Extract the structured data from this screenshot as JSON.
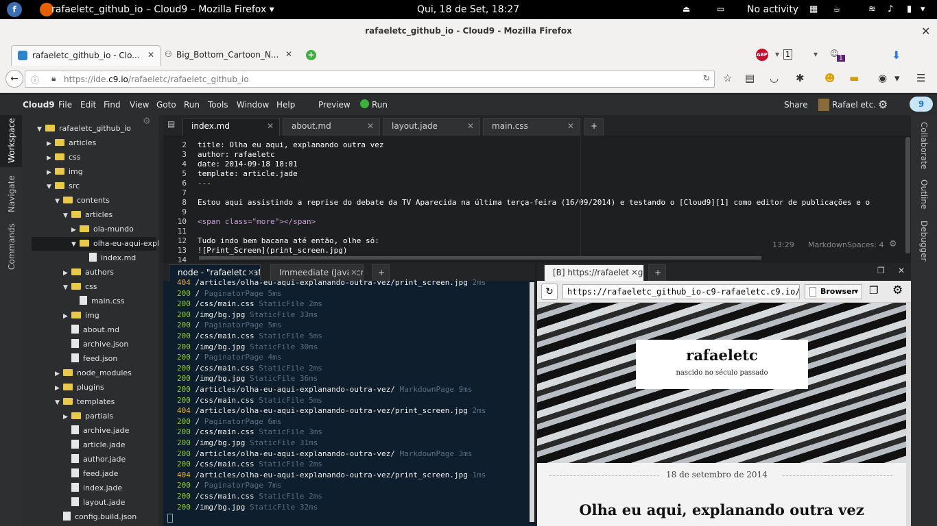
{
  "gnome": {
    "app_title": "rafaeletc_github_io – Cloud9 – Mozilla Firefox ▾",
    "clock": "Qui, 18 de Set, 18:27",
    "activity": "No activity"
  },
  "firefox": {
    "window_title": "rafaeletc_github_io - Cloud9 - Mozilla Firefox",
    "tabs": [
      {
        "label": "rafaeletc_github_io - Clo..."
      },
      {
        "label": "Big_Bottom_Cartoon_N..."
      }
    ],
    "url_prefix": "https://ide.",
    "url_host": "c9.io",
    "url_path": "/rafaeletc/rafaeletc_github_io",
    "badge_count": "1",
    "abp": "ABP"
  },
  "c9menu": {
    "items": [
      "Cloud9",
      "File",
      "Edit",
      "Find",
      "View",
      "Goto",
      "Run",
      "Tools",
      "Window",
      "Help"
    ],
    "preview": "Preview",
    "run": "Run",
    "share": "Share",
    "user": "Rafael etc."
  },
  "rails": {
    "left": [
      "Workspace",
      "Navigate",
      "Commands"
    ],
    "right": [
      "Collaborate",
      "Outline",
      "Debugger"
    ]
  },
  "tree": [
    {
      "label": "rafaeletc_github_io",
      "type": "folder",
      "open": true,
      "depth": 0
    },
    {
      "label": "articles",
      "type": "folder",
      "open": false,
      "depth": 1
    },
    {
      "label": "css",
      "type": "folder",
      "open": false,
      "depth": 1
    },
    {
      "label": "img",
      "type": "folder",
      "open": false,
      "depth": 1
    },
    {
      "label": "src",
      "type": "folder",
      "open": true,
      "depth": 1
    },
    {
      "label": "contents",
      "type": "folder",
      "open": true,
      "depth": 2
    },
    {
      "label": "articles",
      "type": "folder",
      "open": true,
      "depth": 3
    },
    {
      "label": "ola-mundo",
      "type": "folder",
      "open": false,
      "depth": 4
    },
    {
      "label": "olha-eu-aqui-expla",
      "type": "folder",
      "open": true,
      "depth": 4
    },
    {
      "label": "index.md",
      "type": "file",
      "depth": 5
    },
    {
      "label": "authors",
      "type": "folder",
      "open": false,
      "depth": 3
    },
    {
      "label": "css",
      "type": "folder",
      "open": true,
      "depth": 3
    },
    {
      "label": "main.css",
      "type": "file",
      "depth": 4
    },
    {
      "label": "img",
      "type": "folder",
      "open": false,
      "depth": 3
    },
    {
      "label": "about.md",
      "type": "file",
      "depth": 3
    },
    {
      "label": "archive.json",
      "type": "file",
      "depth": 3
    },
    {
      "label": "feed.json",
      "type": "file",
      "depth": 3
    },
    {
      "label": "node_modules",
      "type": "folder",
      "open": false,
      "depth": 2
    },
    {
      "label": "plugins",
      "type": "folder",
      "open": false,
      "depth": 2
    },
    {
      "label": "templates",
      "type": "folder",
      "open": true,
      "depth": 2
    },
    {
      "label": "partials",
      "type": "folder",
      "open": false,
      "depth": 3
    },
    {
      "label": "archive.jade",
      "type": "file",
      "depth": 3
    },
    {
      "label": "article.jade",
      "type": "file",
      "depth": 3
    },
    {
      "label": "author.jade",
      "type": "file",
      "depth": 3
    },
    {
      "label": "feed.jade",
      "type": "file",
      "depth": 3
    },
    {
      "label": "index.jade",
      "type": "file",
      "depth": 3
    },
    {
      "label": "layout.jade",
      "type": "file",
      "depth": 3
    },
    {
      "label": "config.build.json",
      "type": "file",
      "depth": 2
    }
  ],
  "editor_tabs": [
    "index.md",
    "about.md",
    "layout.jade",
    "main.css"
  ],
  "editor_lines": [
    {
      "n": "2",
      "t": "title: Olha eu aqui, explanando outra vez"
    },
    {
      "n": "3",
      "t": "author: rafaeletc"
    },
    {
      "n": "4",
      "t": "date: 2014-09-18 18:01"
    },
    {
      "n": "5",
      "t": "template: article.jade"
    },
    {
      "n": "6",
      "t": "---"
    },
    {
      "n": "7",
      "t": ""
    },
    {
      "n": "8",
      "t": "Estou aqui assistindo a reprise do debate da TV Aparecida na última terça-feira (16/09/2014) e testando o [Cloud9][1] como editor de publicações e o"
    },
    {
      "n": "9",
      "t": ""
    },
    {
      "n": "10",
      "t": "<span class=\"more\"></span>"
    },
    {
      "n": "11",
      "t": ""
    },
    {
      "n": "12",
      "t": "Tudo indo bem bacana até então, olhe só:"
    },
    {
      "n": "13",
      "t": "![Print_Screen](print_screen.jpg)"
    },
    {
      "n": "14",
      "t": ""
    }
  ],
  "status": {
    "pos": "13:29",
    "mode": "Markdown",
    "spaces": "Spaces: 4"
  },
  "console_tabs": [
    "node - \"rafaeletc-rafa",
    "Immeediate (Javascr"
  ],
  "console_lines": [
    {
      "code": "404",
      "path": "/articles/olha-eu-aqui-explanando-outra-vez/print_screen.jpg",
      "meta": "2ms"
    },
    {
      "code": "200",
      "path": "/",
      "meta": "PaginatorPage 5ms"
    },
    {
      "code": "200",
      "path": "/css/main.css",
      "meta": "StaticFile 2ms"
    },
    {
      "code": "200",
      "path": "/img/bg.jpg",
      "meta": "StaticFile 33ms"
    },
    {
      "code": "200",
      "path": "/",
      "meta": "PaginatorPage 5ms"
    },
    {
      "code": "200",
      "path": "/css/main.css",
      "meta": "StaticFile 5ms"
    },
    {
      "code": "200",
      "path": "/img/bg.jpg",
      "meta": "StaticFile 30ms"
    },
    {
      "code": "200",
      "path": "/",
      "meta": "PaginatorPage 4ms"
    },
    {
      "code": "200",
      "path": "/css/main.css",
      "meta": "StaticFile 2ms"
    },
    {
      "code": "200",
      "path": "/img/bg.jpg",
      "meta": "StaticFile 36ms"
    },
    {
      "code": "200",
      "path": "/articles/olha-eu-aqui-explanando-outra-vez/",
      "meta": "MarkdownPage 9ms"
    },
    {
      "code": "200",
      "path": "/css/main.css",
      "meta": "StaticFile 5ms"
    },
    {
      "code": "404",
      "path": "/articles/olha-eu-aqui-explanando-outra-vez/print_screen.jpg",
      "meta": "2ms"
    },
    {
      "code": "200",
      "path": "/",
      "meta": "PaginatorPage 6ms"
    },
    {
      "code": "200",
      "path": "/css/main.css",
      "meta": "StaticFile 3ms"
    },
    {
      "code": "200",
      "path": "/img/bg.jpg",
      "meta": "StaticFile 31ms"
    },
    {
      "code": "200",
      "path": "/articles/olha-eu-aqui-explanando-outra-vez/",
      "meta": "MarkdownPage 3ms"
    },
    {
      "code": "200",
      "path": "/css/main.css",
      "meta": "StaticFile 2ms"
    },
    {
      "code": "404",
      "path": "/articles/olha-eu-aqui-explanando-outra-vez/print_screen.jpg",
      "meta": "1ms"
    },
    {
      "code": "200",
      "path": "/",
      "meta": "PaginatorPage 7ms"
    },
    {
      "code": "200",
      "path": "/css/main.css",
      "meta": "StaticFile 2ms"
    },
    {
      "code": "200",
      "path": "/img/bg.jpg",
      "meta": "StaticFile 32ms"
    }
  ],
  "preview": {
    "tab": "[B] https://rafaeletc_g",
    "url": "https://rafaeletc_github_io-c9-rafaeletc.c9.io/",
    "browser_btn": "Browser",
    "site_title": "rafaeletc",
    "site_subtitle": "nascido no século passado",
    "date": "18 de setembro de 2014",
    "article_title": "Olha eu aqui, explanando outra vez"
  },
  "colors": {
    "code200": "#8fce2a",
    "code404": "#e8b43a",
    "meta": "#5a6e82",
    "accent": "#2ea3f2"
  }
}
